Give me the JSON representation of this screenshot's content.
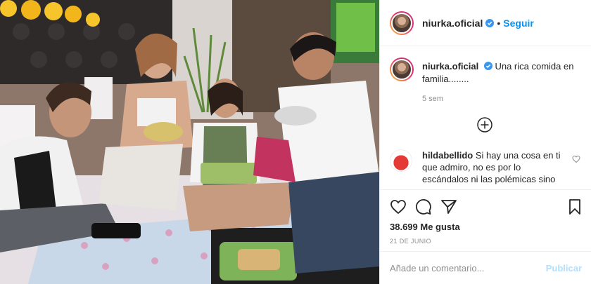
{
  "post": {
    "photo_alt": "",
    "username": "niurka.oficial",
    "follow_label": "Seguir",
    "caption_text": "Una rica comida en familia........",
    "caption_time": "5 sem",
    "comment": {
      "username": "hildabellido",
      "text": "Si hay una cosa en ti que admiro, no es por lo escándalos ni las polémicas sino"
    },
    "likes": "38.699 Me gusta",
    "date": "21 DE JUNIO",
    "add_comment_placeholder": "Añade un comentario...",
    "publish_label": "Publicar"
  },
  "icons": {
    "verified": "verified-badge-icon",
    "load_more": "plus-circle-icon",
    "like": "heart-icon",
    "comment": "comment-bubble-icon",
    "share": "paper-plane-icon",
    "save": "bookmark-icon",
    "comment_like": "heart-small-icon"
  },
  "colors": {
    "link_blue": "#0095f6",
    "publish_disabled": "#b2dffc",
    "muted": "#8e8e8e",
    "border": "#efefef"
  }
}
